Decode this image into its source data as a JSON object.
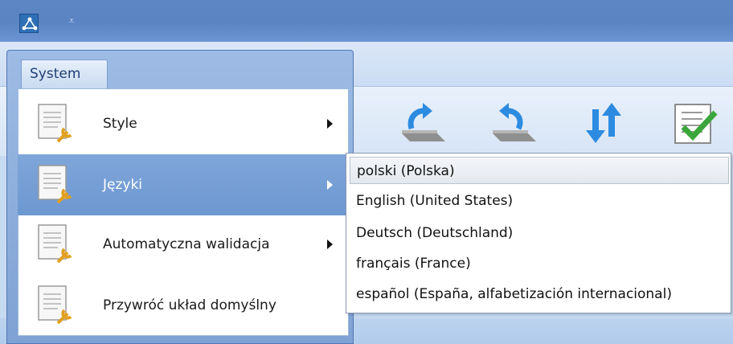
{
  "titlebar": {
    "app_icon": "network-app-icon",
    "qat_icon": "customize-quick-access-arrow-icon",
    "qat_glyph": "⩡"
  },
  "app_menu": {
    "tab_label": "System",
    "items": [
      {
        "label": "Style",
        "icon": "document-wrench-icon",
        "has_submenu": true
      },
      {
        "label": "Języki",
        "icon": "document-wrench-icon",
        "has_submenu": true,
        "highlighted": true
      },
      {
        "label": "Automatyczna walidacja",
        "icon": "document-wrench-icon",
        "has_submenu": true
      },
      {
        "label": "Przywróć układ domyślny",
        "icon": "document-wrench-icon",
        "has_submenu": false
      }
    ]
  },
  "language_submenu": {
    "items": [
      {
        "label": "polski (Polska)",
        "selected": true
      },
      {
        "label": "English (United States)"
      },
      {
        "label": "Deutsch (Deutschland)"
      },
      {
        "label": "français (France)"
      },
      {
        "label": "español (España, alfabetización internacional)"
      }
    ]
  },
  "toolbar": {
    "buttons": [
      {
        "icon": "undo-arrow-icon"
      },
      {
        "icon": "redo-arrow-icon"
      },
      {
        "icon": "sort-arrows-icon"
      },
      {
        "icon": "checklist-validate-icon"
      }
    ]
  },
  "colors": {
    "titlebar": "#5a84c2",
    "menu_highlight": "#7fa6da",
    "ribbon_background": "#d6e4f6",
    "arrow_blue": "#2c8be0",
    "check_green": "#3aa63a"
  }
}
